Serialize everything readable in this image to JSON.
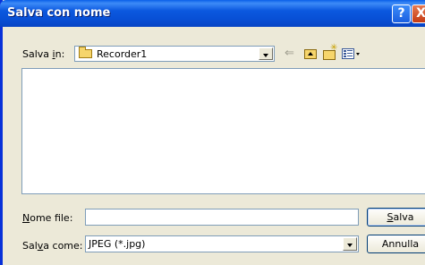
{
  "dialog": {
    "title": "Salva con nome",
    "help_button": "?",
    "close_button": "X"
  },
  "location": {
    "label_prefix": "Salva ",
    "label_accel": "i",
    "label_suffix": "n:",
    "folder": "Recorder1"
  },
  "toolbar": {
    "icons": [
      "back-icon",
      "up-folder-icon",
      "new-folder-icon",
      "views-menu-icon"
    ]
  },
  "file_list": {
    "items": []
  },
  "filename": {
    "label_accel": "N",
    "label_rest": "ome file:",
    "value": ""
  },
  "filetype": {
    "label_prefix": "Sal",
    "label_accel": "v",
    "label_suffix": "a come:",
    "selected": "JPEG (*.jpg)"
  },
  "buttons": {
    "save_accel": "S",
    "save_rest": "alva",
    "cancel": "Annulla"
  }
}
